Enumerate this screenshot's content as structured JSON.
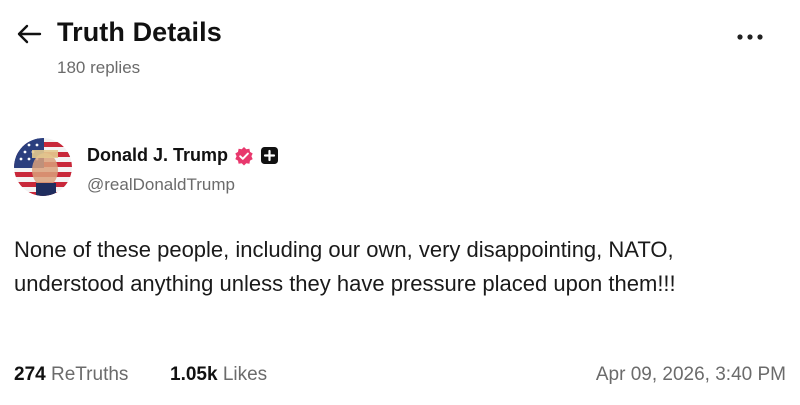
{
  "header": {
    "title": "Truth Details",
    "replies": "180 replies"
  },
  "author": {
    "name": "Donald J. Trump",
    "handle": "@realDonaldTrump",
    "verified_color": "#e8386d"
  },
  "post": {
    "text": "None of these people, including our own, very disappointing, NATO, understood anything unless they have pressure placed upon them!!!"
  },
  "stats": {
    "retruths_count": "274",
    "retruths_label": "ReTruths",
    "likes_count": "1.05k",
    "likes_label": "Likes",
    "timestamp": "Apr 09, 2026, 3:40 PM"
  },
  "icons": {
    "back": "arrow-left-icon",
    "more": "more-horizontal-icon",
    "verified": "verified-badge-icon",
    "add": "plus-square-icon"
  }
}
